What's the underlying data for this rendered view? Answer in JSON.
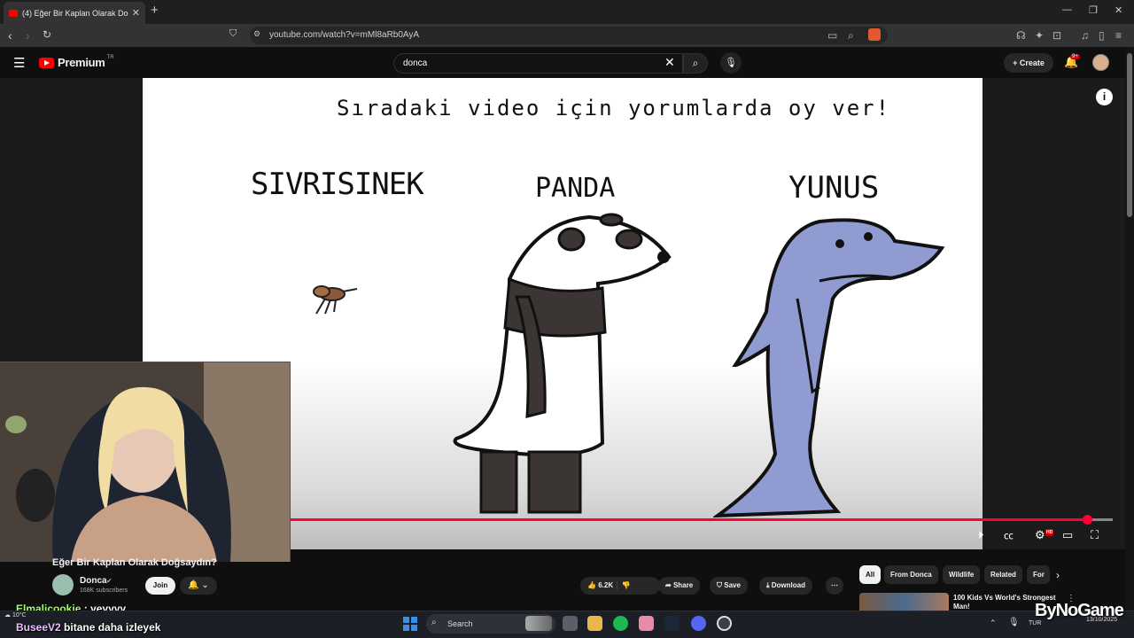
{
  "browser": {
    "tab_title": "(4) Eğer Bir Kaplan Olarak Doğsaydın?",
    "url": "youtube.com/watch?v=mMl8aRb0AyA"
  },
  "youtube": {
    "logo_text": "Premium",
    "logo_country": "TR",
    "search_value": "donca",
    "create_label": "Create",
    "notification_count": "9+"
  },
  "video": {
    "frame_heading": "Sıradaki video için yorumlarda oy ver!",
    "option_1": "SIVRISINEK",
    "option_2": "PANDA",
    "option_3": "YUNUS",
    "progress_fraction": 0.97,
    "title": "Eğer Bir Kaplan Olarak Doğsaydın?"
  },
  "channel": {
    "name": "Donca",
    "subscribers": "168K subscribers",
    "join_label": "Join"
  },
  "actions": {
    "likes": "6.2K",
    "share": "Share",
    "save": "Save",
    "download": "Download"
  },
  "chips": [
    "All",
    "From Donca",
    "Wildlife",
    "Related",
    "For"
  ],
  "recommendation": {
    "title": "100 Kids Vs World's Strongest Man!"
  },
  "chat": [
    {
      "user": "Elmalicookie",
      "message": ": yeyyyy"
    },
    {
      "user": "BuseeV2",
      "message": "bitane daha izleyek"
    }
  ],
  "weather": "10°C",
  "taskbar": {
    "search_label": "Search",
    "lang": "TUR",
    "time": "",
    "date": "13/10/2025"
  },
  "watermark": "ByNoGame",
  "colors": {
    "accent": "#ff0033",
    "youtube_red": "#ff0000",
    "dolphin": "#8f9bd1"
  }
}
